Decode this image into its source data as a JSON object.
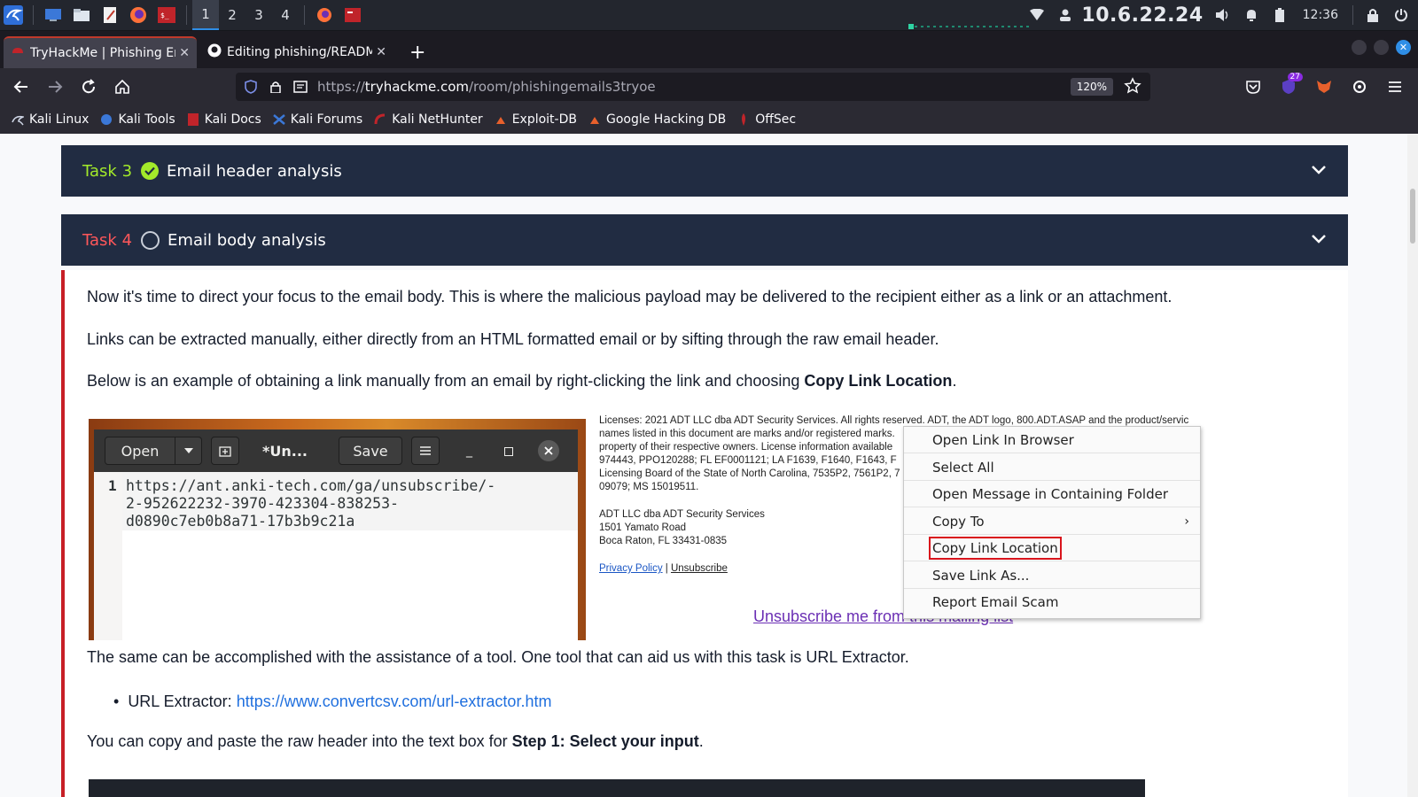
{
  "taskbar": {
    "workspaces": [
      "1",
      "2",
      "3",
      "4"
    ],
    "ip": "10.6.22.24",
    "clock": "12:36"
  },
  "browser": {
    "tabs": [
      {
        "title": "TryHackMe | Phishing Em"
      },
      {
        "title": "Editing phishing/README"
      }
    ],
    "url_prefix": "https://",
    "url_host": "tryhackme.com",
    "url_path": "/room/phishingemails3tryoe",
    "zoom": "120%",
    "extensions_badge": "27",
    "bookmarks": [
      "Kali Linux",
      "Kali Tools",
      "Kali Docs",
      "Kali Forums",
      "Kali NetHunter",
      "Exploit-DB",
      "Google Hacking DB",
      "OffSec"
    ]
  },
  "tasks": [
    {
      "num": "Task 3",
      "title": "Email header analysis",
      "done": true
    },
    {
      "num": "Task 4",
      "title": "Email body analysis",
      "done": false
    }
  ],
  "content": {
    "p1": "Now it's time to direct your focus to the email body. This is where the malicious payload may be delivered to the recipient either as a link or an attachment.",
    "p2": "Links can be extracted manually, either directly from an HTML formatted email or by sifting through the raw email header.",
    "p3_pre": "Below is an example of obtaining a link manually from an email by right-clicking the link and choosing ",
    "p3_bold": "Copy Link Location",
    "p3_post": ".",
    "p4": "The same can be accomplished with the assistance of a tool. One tool that can aid us with this task is URL Extractor.",
    "bullet_label": "URL Extractor: ",
    "bullet_link": "https://www.convertcsv.com/url-extractor.htm",
    "p5_pre": "You can copy and paste the raw header into the text box for ",
    "p5_bold": "Step 1: Select your input",
    "p5_post": "."
  },
  "gedit": {
    "open_label": "Open",
    "title": "*Un...",
    "save_label": "Save",
    "line_number": "1",
    "lines": [
      "https://ant.anki-tech.com/ga/unsubscribe/-",
      "2-952622232-3970-423304-838253-",
      "d0890c7eb0b8a71-17b3b9c21a"
    ]
  },
  "email": {
    "lines": [
      "Licenses: 2021 ADT LLC dba ADT Security Services. All rights reserved. ADT, the ADT logo, 800.ADT.ASAP and the product/servic",
      "names listed in this document are marks and/or registered marks.",
      "property of their respective owners. License information available",
      "974443, PPO120288; FL EF0001121; LA F1639, F1640, F1643, F",
      "Licensing Board of the State of North Carolina, 7535P2, 7561P2, 7",
      "09079; MS 15019511."
    ],
    "address": [
      "ADT LLC dba ADT Security Services",
      "1501 Yamato Road",
      "Boca Raton, FL 33431-0835"
    ],
    "privacy": "Privacy Policy",
    "sep": " | ",
    "unsubscribe": "Unsubscribe",
    "unsub_big": "Unsubscribe me from this mailing list"
  },
  "context_menu": [
    "Open Link In Browser",
    "Select All",
    "Open Message in Containing Folder",
    "Copy To",
    "Copy Link Location",
    "Save Link As...",
    "Report Email Scam"
  ]
}
